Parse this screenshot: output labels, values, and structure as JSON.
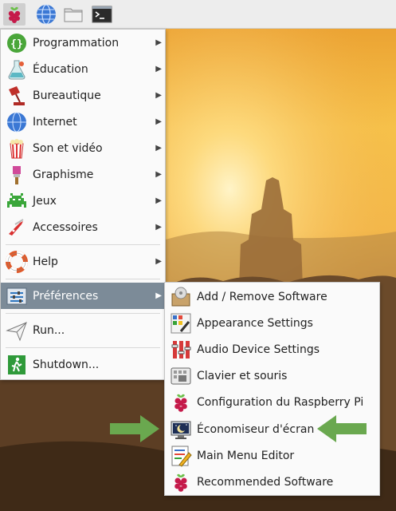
{
  "taskbar": {
    "buttons": [
      {
        "icon": "raspberry-pi-menu-icon"
      },
      {
        "icon": "web-browser-icon"
      },
      {
        "icon": "file-manager-icon"
      },
      {
        "icon": "terminal-icon"
      }
    ]
  },
  "main_menu": {
    "items": [
      {
        "label": "Programmation",
        "icon": "programming-icon",
        "submenu": true
      },
      {
        "label": "Éducation",
        "icon": "education-flask-icon",
        "submenu": true
      },
      {
        "label": "Bureautique",
        "icon": "office-lamp-icon",
        "submenu": true
      },
      {
        "label": "Internet",
        "icon": "internet-globe-icon",
        "submenu": true
      },
      {
        "label": "Son et vidéo",
        "icon": "sound-video-icon",
        "submenu": true
      },
      {
        "label": "Graphisme",
        "icon": "graphics-brush-icon",
        "submenu": true
      },
      {
        "label": "Jeux",
        "icon": "games-invader-icon",
        "submenu": true
      },
      {
        "label": "Accessoires",
        "icon": "accessories-knife-icon",
        "submenu": true
      },
      {
        "label": "Help",
        "icon": "help-lifebuoy-icon",
        "submenu": true
      },
      {
        "label": "Préférences",
        "icon": "preferences-icon",
        "submenu": true,
        "selected": true
      },
      {
        "label": "Run...",
        "icon": "run-paper-plane-icon",
        "submenu": false
      },
      {
        "label": "Shutdown...",
        "icon": "shutdown-exit-icon",
        "submenu": false
      }
    ]
  },
  "preferences_submenu": {
    "items": [
      {
        "label": "Add / Remove Software",
        "icon": "add-remove-software-icon"
      },
      {
        "label": "Appearance Settings",
        "icon": "appearance-settings-icon"
      },
      {
        "label": "Audio Device Settings",
        "icon": "audio-device-settings-icon"
      },
      {
        "label": "Clavier et souris",
        "icon": "keyboard-mouse-icon"
      },
      {
        "label": "Configuration du Raspberry Pi",
        "icon": "raspberry-pi-config-icon"
      },
      {
        "label": "Économiseur d'écran",
        "icon": "screensaver-monitor-icon",
        "highlighted_by_arrows": true
      },
      {
        "label": "Main Menu Editor",
        "icon": "main-menu-editor-icon"
      },
      {
        "label": "Recommended Software",
        "icon": "recommended-software-icon"
      }
    ]
  },
  "colors": {
    "selected_item": "#7c8b98",
    "annotation_arrow": "#6aa84f",
    "raspberry_red": "#c51a4a",
    "raspberry_leaf": "#6cc04a"
  }
}
